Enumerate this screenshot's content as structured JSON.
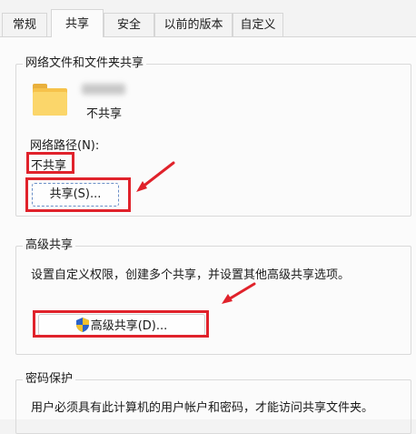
{
  "tabs": [
    {
      "label": "常规"
    },
    {
      "label": "共享"
    },
    {
      "label": "安全"
    },
    {
      "label": "以前的版本"
    },
    {
      "label": "自定义"
    }
  ],
  "network_share": {
    "title": "网络文件和文件夹共享",
    "status": "不共享",
    "path_label": "网络路径(N):",
    "path_value": "不共享",
    "share_button": "共享(S)..."
  },
  "advanced_share": {
    "title": "高级共享",
    "description": "设置自定义权限，创建多个共享，并设置其他高级共享选项。",
    "button": "高级共享(D)..."
  },
  "password": {
    "title": "密码保护",
    "description": "用户必须具有此计算机的用户帐户和密码，才能访问共享文件夹。"
  },
  "icons": {
    "folder": "folder-icon",
    "shield": "uac-shield-icon"
  },
  "colors": {
    "annotation_red": "#e0222b"
  }
}
